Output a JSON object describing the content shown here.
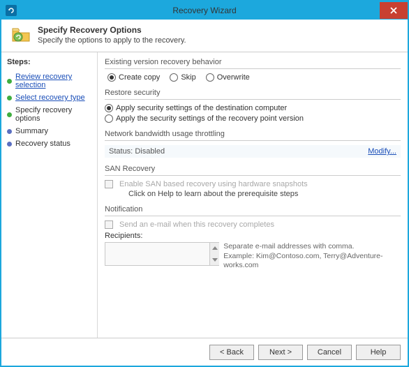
{
  "window": {
    "title": "Recovery Wizard"
  },
  "header": {
    "title": "Specify Recovery Options",
    "subtitle": "Specify the options to apply to the recovery."
  },
  "sidebar": {
    "heading": "Steps:",
    "items": [
      {
        "label": "Review recovery selection",
        "state": "done"
      },
      {
        "label": "Select recovery type",
        "state": "done"
      },
      {
        "label": "Specify recovery options",
        "state": "current"
      },
      {
        "label": "Summary",
        "state": "pending"
      },
      {
        "label": "Recovery status",
        "state": "pending"
      }
    ]
  },
  "existing": {
    "caption": "Existing version recovery behavior",
    "options": {
      "create_copy": "Create copy",
      "skip": "Skip",
      "overwrite": "Overwrite"
    },
    "selected": "create_copy"
  },
  "restore_security": {
    "caption": "Restore security",
    "opt_dest": "Apply security settings of the destination computer",
    "opt_rp": "Apply the security settings of the recovery point version",
    "selected": "dest"
  },
  "throttle": {
    "caption": "Network bandwidth usage throttling",
    "status_label": "Status:",
    "status_value": "Disabled",
    "modify": "Modify..."
  },
  "san": {
    "caption": "SAN Recovery",
    "checkbox": "Enable SAN based recovery using hardware snapshots",
    "hint": "Click on Help to learn about the prerequisite steps"
  },
  "notify": {
    "caption": "Notification",
    "checkbox": "Send an e-mail when this recovery completes",
    "recipients_label": "Recipients:",
    "hint1": "Separate e-mail addresses with comma.",
    "hint2": "Example: Kim@Contoso.com, Terry@Adventure-works.com"
  },
  "footer": {
    "back": "< Back",
    "next": "Next >",
    "cancel": "Cancel",
    "help": "Help"
  }
}
